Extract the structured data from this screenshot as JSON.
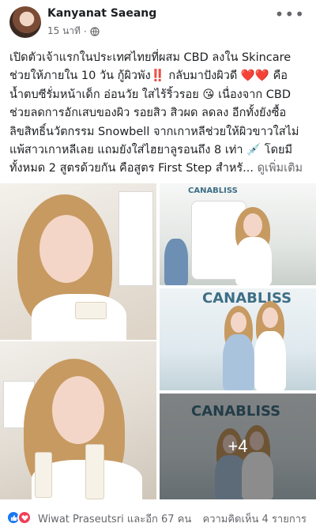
{
  "post": {
    "author": "Kanyanat Saeang",
    "timestamp": "15 นาที",
    "privacy_icon": "globe-icon",
    "more_icon": "ellipsis-icon",
    "text_lines": [
      "เปิดตัวเจ้าแรกในประเทศไทยที่ผสม CBD ลงใน Skincare",
      "ช่วยให้ภายใน 10 วัน กู้ผิวพัง‼️ กลับมาปังผิวดี ❤️❤️ คือ",
      "น้ำตบซีรั่มหน้าเด็ก อ่อนวัย ใสไร้ริ้วรอย 😘 เนื่องจาก CBD",
      "ช่วยลดการอักเสบของผิว รอยสิว สิวผด ลดลง อีกทั้งยังซื้อ",
      "ลิขสิทธิ์นวัตกรรม Snowbell จากเกาหลีช่วยให้ผิวขาวใสไม่",
      "แพ้สาวเกาหลีเลย แถมยังใส่ไฮยาลูรอนถึง 8 เท่า 💉 โดยมี",
      "ทั้งหมด 2 สูตรด้วยกัน คือสูตร First Step สำหรั..."
    ],
    "see_more": "ดูเพิ่มเติม"
  },
  "photos": {
    "banner_word": "CANABLISS",
    "banner_word_alt": "CANABLISS",
    "more_count": "+4"
  },
  "footer": {
    "reactions_text": "Wiwat Praseutsri และอีก 67 คน",
    "comments_text": "ความคิดเห็น 4 รายการ",
    "like_icon": "thumbs-up-icon",
    "love_icon": "heart-icon"
  },
  "colors": {
    "text": "#1c1e21",
    "secondary": "#65676b",
    "like": "#1877f2",
    "love": "#f33e58"
  }
}
